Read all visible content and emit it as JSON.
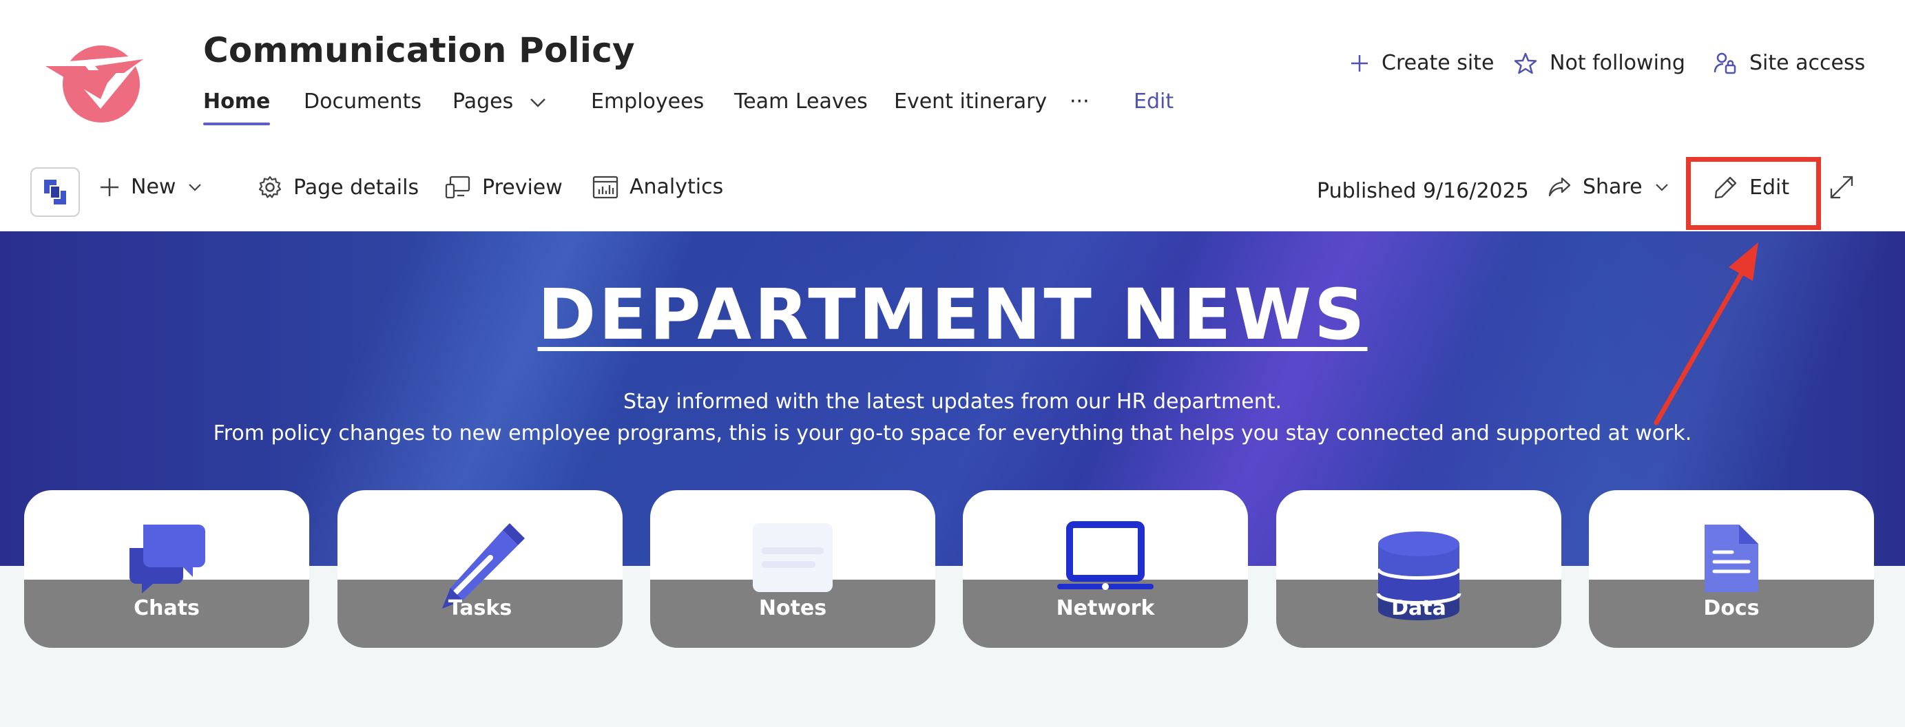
{
  "site": {
    "title": "Communication Policy",
    "brand_color": "#ee6c7f"
  },
  "nav": {
    "items": [
      {
        "label": "Home",
        "active": true
      },
      {
        "label": "Documents"
      },
      {
        "label": "Pages"
      },
      {
        "label": "Employees"
      },
      {
        "label": "Team Leaves"
      },
      {
        "label": "Event itinerary"
      },
      {
        "label": "···"
      },
      {
        "label": "Edit"
      }
    ]
  },
  "site_actions": {
    "create_site": "Create site",
    "not_following": "Not following",
    "site_access": "Site access"
  },
  "command_bar": {
    "new": "New",
    "page_details": "Page details",
    "preview": "Preview",
    "analytics": "Analytics",
    "published": "Published 9/16/2025",
    "share": "Share",
    "edit": "Edit"
  },
  "banner": {
    "title": "DEPARTMENT NEWS",
    "line1": "Stay informed with the latest updates from our HR department.",
    "line2": "From policy changes to new employee programs, this is your go-to space for everything that helps you stay connected and supported at work."
  },
  "tiles": [
    {
      "label": "Chats",
      "icon": "chat-icon"
    },
    {
      "label": "Tasks",
      "icon": "pencil-icon"
    },
    {
      "label": "Notes",
      "icon": "notes-icon"
    },
    {
      "label": "Network",
      "icon": "laptop-icon"
    },
    {
      "label": "Data",
      "icon": "database-icon"
    },
    {
      "label": "Docs",
      "icon": "document-icon"
    }
  ],
  "colors": {
    "accent": "#5b5fc7",
    "highlight": "#e8392c",
    "tile_icon": "#5561e0"
  }
}
